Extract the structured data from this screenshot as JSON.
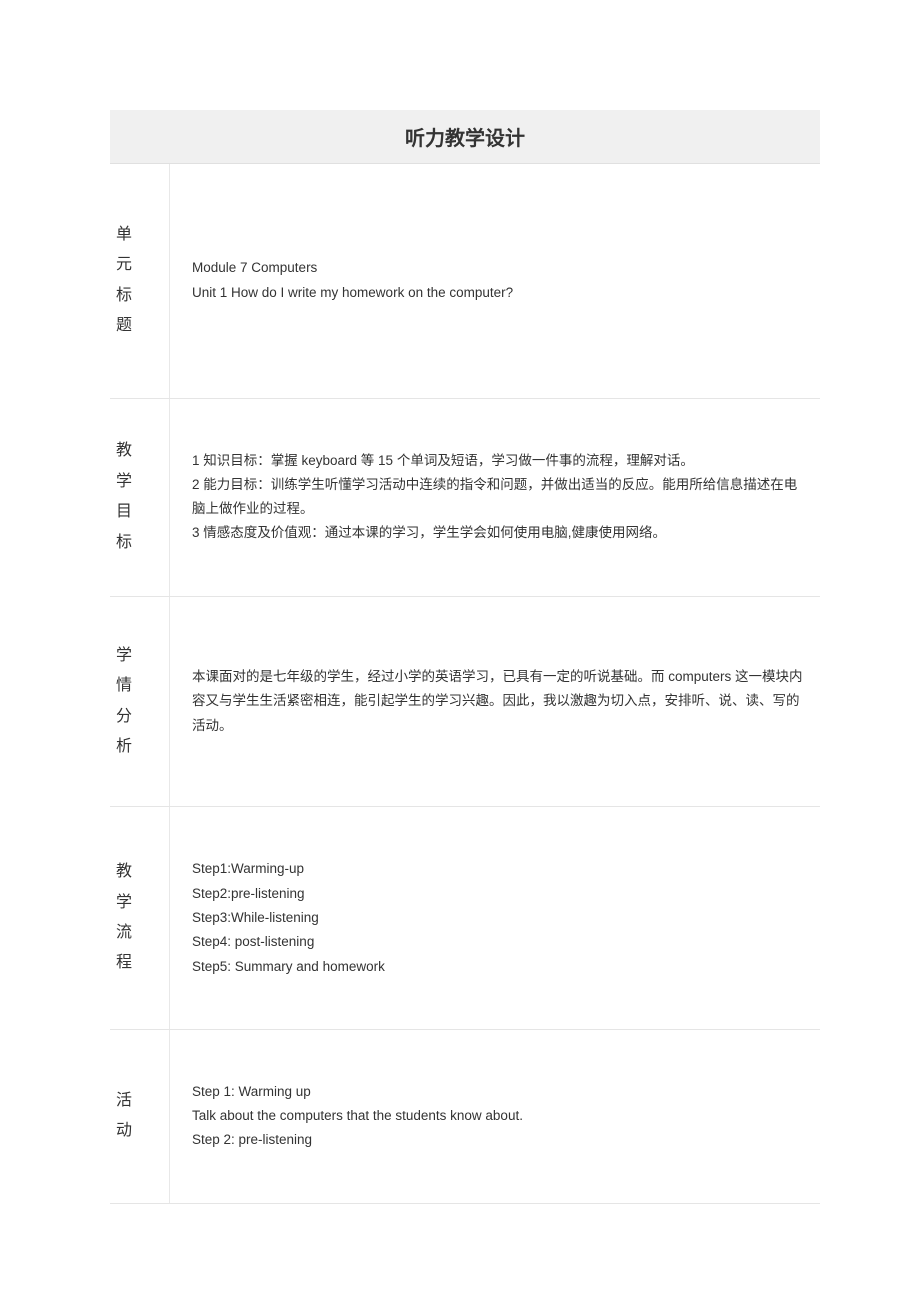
{
  "title": "听力教学设计",
  "sections": {
    "unitTitle": {
      "label": "单元标题",
      "lines": [
        "Module 7 Computers",
        "Unit 1 How do I write my homework on the computer?"
      ]
    },
    "teachingGoals": {
      "label": "教学目标",
      "lines": [
        "1 知识目标：掌握 keyboard 等 15 个单词及短语，学习做一件事的流程，理解对话。",
        "2 能力目标：训练学生听懂学习活动中连续的指令和问题，并做出适当的反应。能用所给信息描述在电脑上做作业的过程。",
        "3 情感态度及价值观：通过本课的学习，学生学会如何使用电脑,健康使用网络。"
      ]
    },
    "studentAnalysis": {
      "label": "学情分析",
      "lines": [
        "本课面对的是七年级的学生，经过小学的英语学习，已具有一定的听说基础。而 computers 这一模块内容又与学生生活紧密相连，能引起学生的学习兴趣。因此，我以激趣为切入点，安排听、说、读、写的活动。"
      ]
    },
    "teachingFlow": {
      "label": "教学流程",
      "lines": [
        "Step1:Warming-up",
        "Step2:pre-listening",
        "Step3:While-listening",
        "Step4: post-listening",
        "Step5: Summary and homework"
      ]
    },
    "activity": {
      "label": "活动",
      "lines": [
        "Step 1: Warming up",
        "Talk about the computers that the students know about.",
        "Step 2: pre-listening"
      ]
    }
  }
}
